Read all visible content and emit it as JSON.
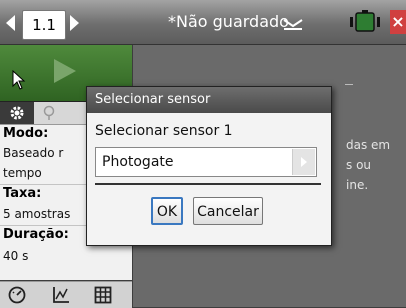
{
  "topbar": {
    "page_number": "1.1",
    "document_title": "*Não guardado",
    "icons": [
      "nav-left-icon",
      "nav-right-icon",
      "chevron-down-icon",
      "battery-icon",
      "close-icon"
    ]
  },
  "left_panel": {
    "settings": [
      {
        "label": "Modo:",
        "value_lines": [
          "Baseado r",
          "tempo"
        ]
      },
      {
        "label": "Taxa:",
        "value_lines": [
          "5 amostras"
        ]
      },
      {
        "label": "Duração:",
        "value_lines": [
          "40 s"
        ]
      }
    ]
  },
  "background_hint": {
    "lines": [
      "das em",
      "s ou",
      "ine."
    ]
  },
  "dialog": {
    "title": "Selecionar sensor",
    "label": "Selecionar sensor 1",
    "selected_sensor": "Photogate",
    "ok_label": "OK",
    "cancel_label": "Cancelar"
  },
  "colors": {
    "start_button": "#2f6322",
    "dialog_title_bar": "#4a4a4a",
    "ok_focus": "#3a78c0",
    "close": "#d04040"
  }
}
